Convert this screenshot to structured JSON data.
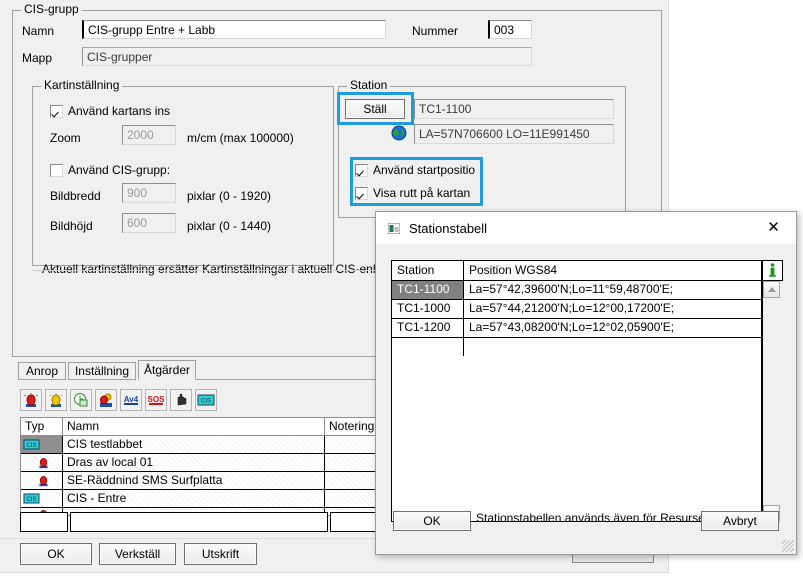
{
  "main": {
    "group_cis": {
      "title": "CIS-grupp",
      "namn_label": "Namn",
      "namn_value": "CIS-grupp Entre + Labb",
      "mapp_label": "Mapp",
      "mapp_value": "CIS-grupper",
      "nummer_label": "Nummer",
      "nummer_value": "003"
    },
    "group_kart": {
      "title": "Kartinställning",
      "chk_kartans": "Använd kartans ins",
      "zoom_label": "Zoom",
      "zoom_value": "2000",
      "zoom_unit": "m/cm (max 100000)",
      "chk_cisgrupp": "Använd CIS-grupp:",
      "bildbredd_label": "Bildbredd",
      "bildbredd_value": "900",
      "bildbredd_unit": "pixlar  (0 - 1920)",
      "bildhojd_label": "Bildhöjd",
      "bildhojd_value": "600",
      "bildhojd_unit": "pixlar  (0 - 1440)"
    },
    "group_station": {
      "title": "Station",
      "stall_button": "Ställ",
      "station_value": "TC1-1100",
      "position_value": "LA=57N706600 LO=11E991450",
      "chk_startposition": "Använd startpositio",
      "chk_visa_rutt": "Visa rutt på kartan"
    },
    "info_text": "Aktuell kartinställning ersätter Kartinställningar i aktuell CIS-enheter",
    "tabs": [
      {
        "label": "Anrop",
        "active": false
      },
      {
        "label": "Inställning",
        "active": false
      },
      {
        "label": "Åtgärder",
        "active": true
      }
    ],
    "toolbar": [
      {
        "name": "alarm-red-icon"
      },
      {
        "name": "alarm-yellow-icon"
      },
      {
        "name": "clock-refresh-icon"
      },
      {
        "name": "alarm-group-icon"
      },
      {
        "name": "av4-icon"
      },
      {
        "name": "sos-icon"
      },
      {
        "name": "hand-icon"
      },
      {
        "name": "cis-icon"
      }
    ],
    "list": {
      "columns": [
        "Typ",
        "Namn",
        "Notering"
      ],
      "rows": [
        {
          "typ": "cis-icon",
          "namn": "CIS testlabbet",
          "notering": "",
          "selected": true
        },
        {
          "typ": "alarm-icon",
          "namn": "Dras av local 01",
          "notering": "",
          "selected": false
        },
        {
          "typ": "alarm-icon",
          "namn": "SE-Räddnind SMS Surfplatta",
          "notering": "",
          "selected": false
        },
        {
          "typ": "cis-icon",
          "namn": "CIS - Entre",
          "notering": "",
          "selected": false
        },
        {
          "typ": "alarm-icon",
          "namn": "",
          "notering": "",
          "selected": false
        }
      ]
    },
    "buttons": {
      "ok": "OK",
      "verkstall": "Verkställ",
      "utskrift": "Utskrift"
    }
  },
  "dialog": {
    "title": "Stationstabell",
    "close_icon": "close-icon",
    "info_icon": "info-green-icon",
    "columns": [
      "Station",
      "Position WGS84"
    ],
    "rows": [
      {
        "station": "TC1-1100",
        "position": "La=57°42,39600'N;Lo=11°59,48700'E;",
        "selected": true
      },
      {
        "station": "TC1-1000",
        "position": "La=57°44,21200'N;Lo=12°00,17200'E;",
        "selected": false
      },
      {
        "station": "TC1-1200",
        "position": "La=57°43,08200'N;Lo=12°02,05900'E;",
        "selected": false
      }
    ],
    "ok_label": "OK",
    "note": "Stationstabellen används även för Resurser.",
    "cancel_label": "Avbryt"
  },
  "colors": {
    "highlight": "#1e9ae0",
    "window_bg": "#f0f0f0",
    "selection": "#808080"
  }
}
